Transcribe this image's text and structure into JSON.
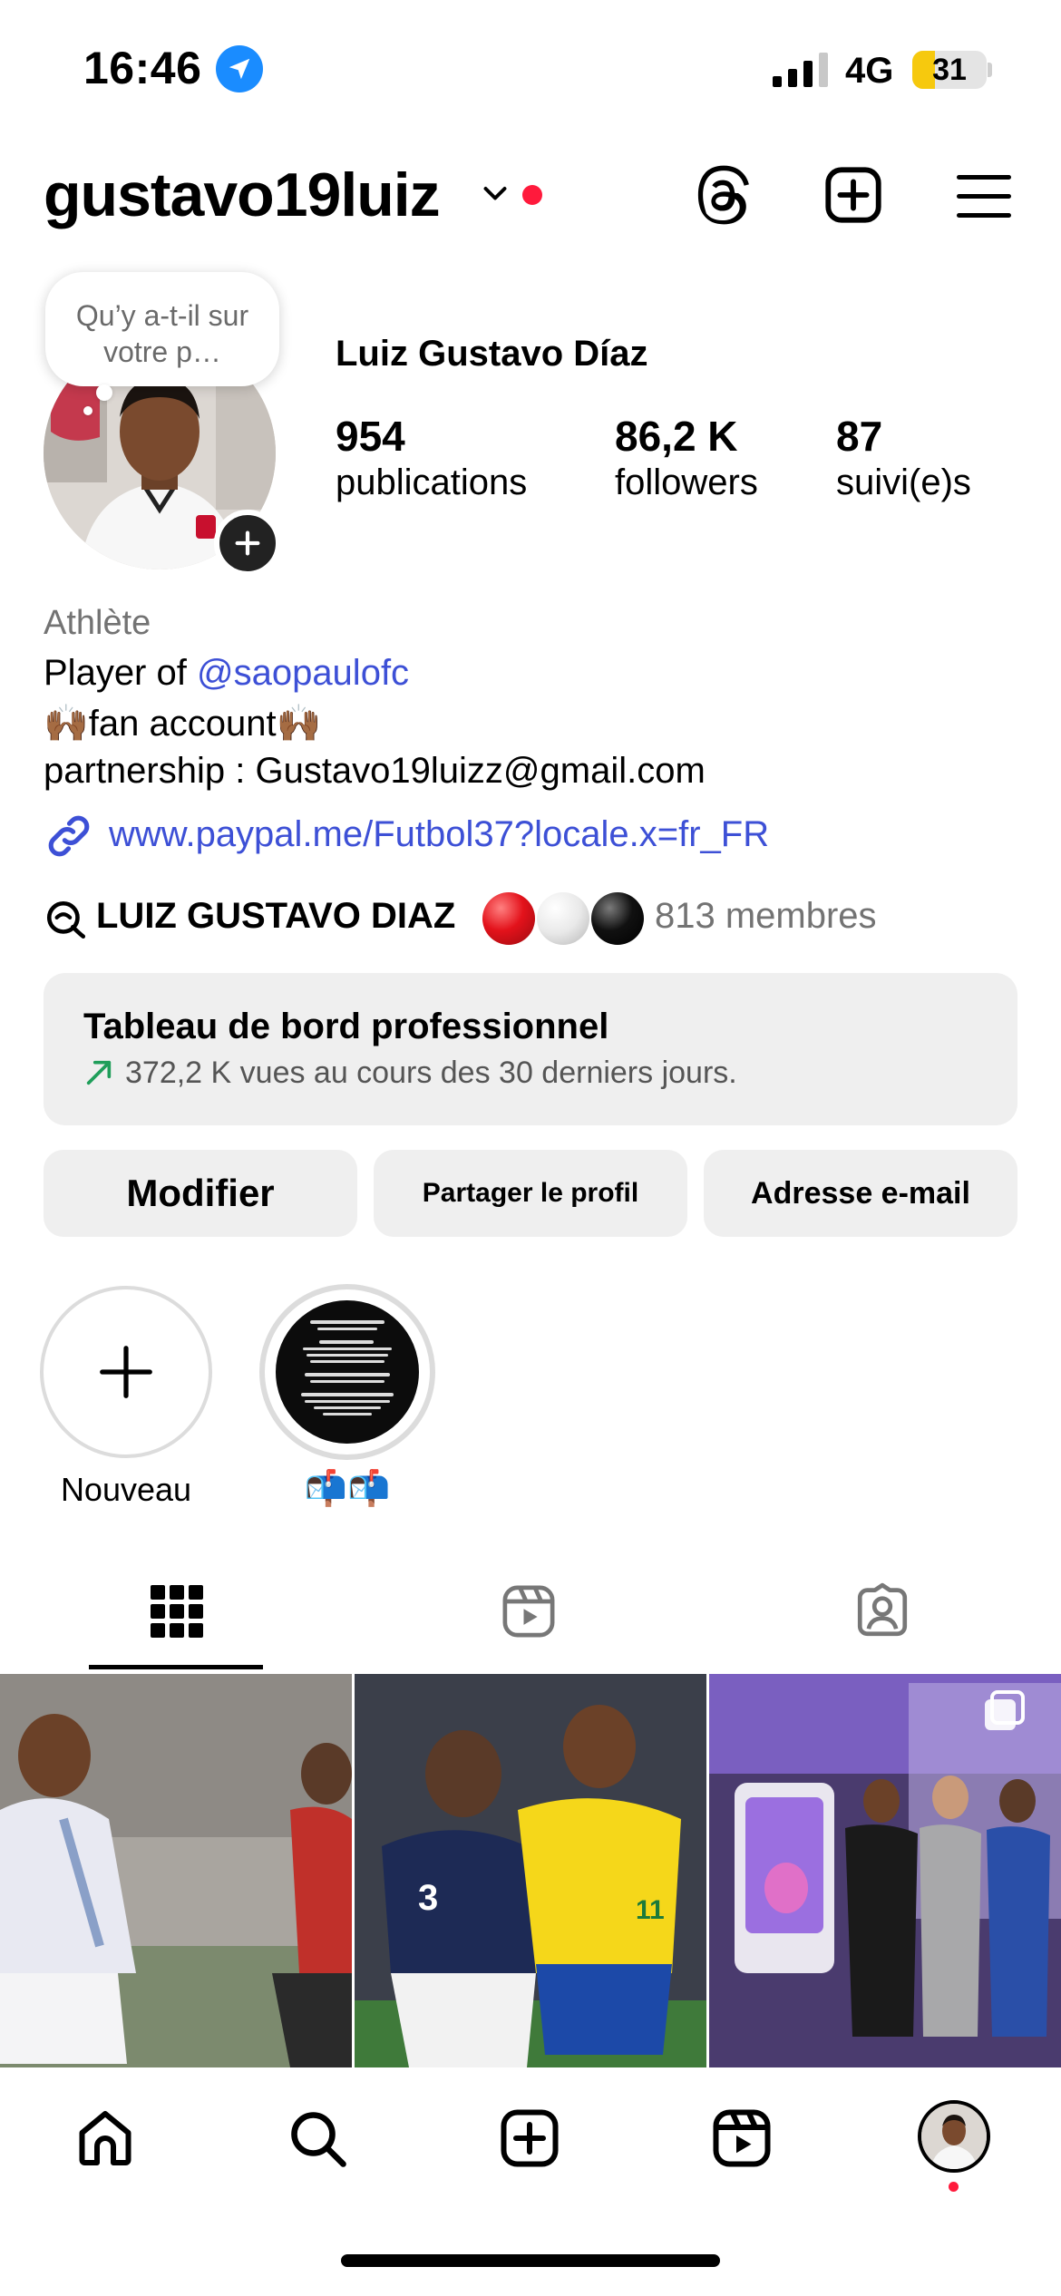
{
  "status_bar": {
    "time": "16:46",
    "network": "4G",
    "battery": "31"
  },
  "header": {
    "username": "gustavo19luiz"
  },
  "note": {
    "text": "Qu’y a-t-il sur votre p…"
  },
  "profile": {
    "display_name": "Luiz Gustavo Díaz",
    "stats": [
      {
        "value": "954",
        "label": "publications"
      },
      {
        "value": "86,2 K",
        "label": "followers"
      },
      {
        "value": "87",
        "label": "suivi(e)s"
      }
    ]
  },
  "bio": {
    "category": "Athlète",
    "line1_prefix": "Player of ",
    "line1_mention": "@saopaulofc",
    "line2": "🙌🏾fan account🙌🏾",
    "line3": "partnership : Gustavo19luizz@gmail.com",
    "link": "www.paypal.me/Futbol37?locale.x=fr_FR"
  },
  "channel": {
    "name": "LUIZ GUSTAVO DIAZ",
    "members": "813 membres",
    "ball_colors": [
      "#e3121b",
      "#e9e9e9",
      "#111111"
    ]
  },
  "dashboard": {
    "title": "Tableau de bord professionnel",
    "subtitle": "372,2 K vues au cours des 30 derniers jours.",
    "trend_color": "#1f9e5a"
  },
  "buttons": {
    "edit": "Modifier",
    "share": "Partager le profil",
    "email": "Adresse e-mail"
  },
  "highlights": [
    {
      "label": "Nouveau"
    },
    {
      "label": "📬📬"
    }
  ],
  "tabs": [
    "grid",
    "reels",
    "tagged"
  ],
  "colors": {
    "link": "#3d50d6",
    "notification": "#ff1a3c",
    "button_bg": "#efefef"
  }
}
